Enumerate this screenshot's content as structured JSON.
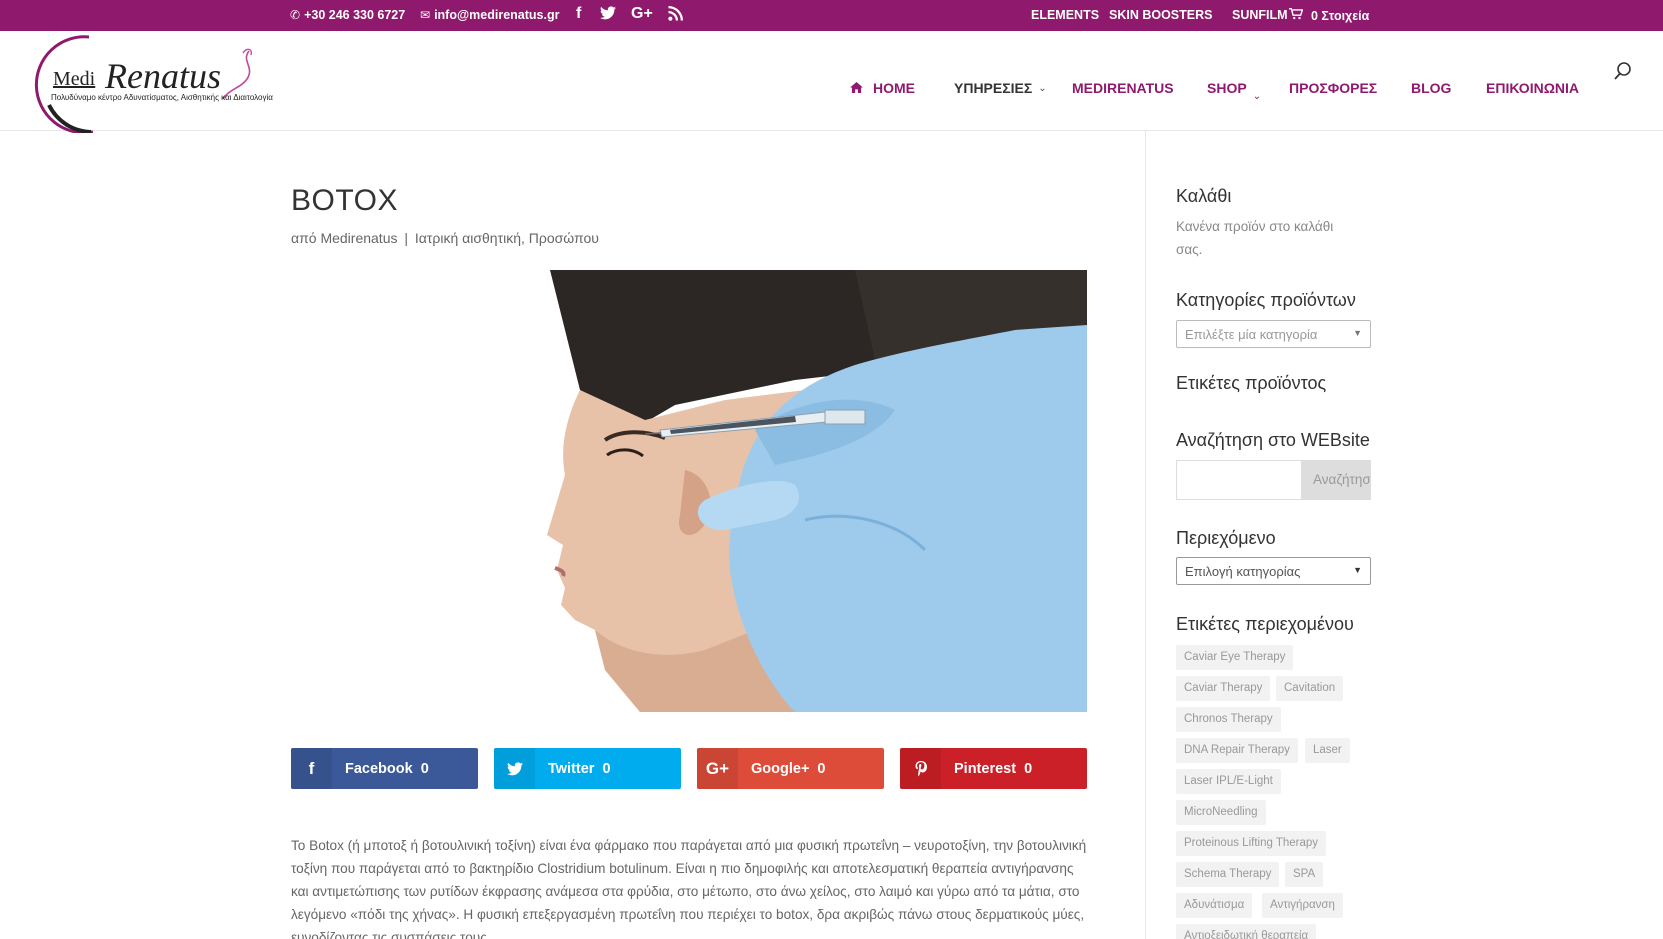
{
  "topbar": {
    "phone": "+30 246 330 6727",
    "email": "info@medirenatus.gr",
    "links": [
      "ELEMENTS",
      "SKIN BOOSTERS",
      "SUNFILM"
    ],
    "cart": "0 Στοιχεία",
    "bg_color": "#8f1a6d"
  },
  "logo": {
    "name_part1": "Medi",
    "name_part2": "Renatus",
    "tagline": "Πολυδύναμο κέντρο Αδυνατίσματος, Αισθητικής και Διαιτολογίας"
  },
  "nav": {
    "home": "HOME",
    "services": "ΥΠΗΡΕΣΙΕΣ",
    "medirenatus": "MEDIRENATUS",
    "shop": "SHOP",
    "offers": "ΠΡΟΣΦΟΡΕΣ",
    "blog": "BLOG",
    "contact": "ΕΠΙΚΟΙΝΩΝΙΑ"
  },
  "post": {
    "title": "BOTOX",
    "meta_author_prefix": "από",
    "meta_author": "Medirenatus",
    "meta_separator": "|",
    "meta_category_1": "Ιατρική αισθητική",
    "meta_category_2": "Προσώπου",
    "body": "Το Botox (ή μποτοξ ή βοτουλινική τοξίνη) είναι ένα φάρμακο που παράγεται από μια φυσική πρωτεΐνη – νευροτοξίνη, την βοτουλινική τοξίνη που παράγεται από το βακτηρίδιο Clostridium botulinum. Είναι η πιο δημοφιλής και αποτελεσματική θεραπεία αντιγήρανσης και αντιμετώπισης των ρυτίδων έκφρασης ανάμεσα στα φρύδια, στο μέτωπο, στο άνω χείλος, στο λαιμό και γύρω από τα μάτια, στο λεγόμενο «πόδι της χήνας». Η φυσική επεξεργασμένη πρωτεΐνη που περιέχει το botox, δρα ακριβώς πάνω στους δερματικούς μύες, ευνοδίζοντας τις συσπάσεις τους."
  },
  "share": [
    {
      "label": "Facebook",
      "count": "0",
      "color": "#3b5998",
      "icon": "facebook-icon"
    },
    {
      "label": "Twitter",
      "count": "0",
      "color": "#00aced",
      "icon": "twitter-icon"
    },
    {
      "label": "Google+",
      "count": "0",
      "color": "#dd4b39",
      "icon": "google-plus-icon"
    },
    {
      "label": "Pinterest",
      "count": "0",
      "color": "#cb2027",
      "icon": "pinterest-icon"
    }
  ],
  "sidebar": {
    "cart_title": "Καλάθι",
    "cart_empty": "Κανένα προϊόν στο καλάθι σας.",
    "product_categories_title": "Κατηγορίες προϊόντων",
    "product_categories_select": "Επιλέξτε μία κατηγορία",
    "product_tags_title": "Ετικέτες προϊόντος",
    "search_title": "Αναζήτηση στο WEBsite",
    "search_value": "",
    "search_button": "Αναζήτηση",
    "content_title": "Περιεχόμενο",
    "content_select": "Επιλογή κατηγορίας",
    "content_tags_title": "Ετικέτες περιεχομένου",
    "tags": [
      "Caviar Eye Therapy",
      "Caviar Therapy",
      "Cavitation",
      "Chronos Therapy",
      "DNA Repair Therapy",
      "Laser",
      "Laser IPL/E-Light",
      "MicroNeedling",
      "Proteinous Lifting Therapy",
      "Schema Therapy",
      "SPA",
      "Αδυνάτισμα",
      "Αντιγήρανση",
      "Αντιοξειδωτική θεραπεία"
    ]
  }
}
